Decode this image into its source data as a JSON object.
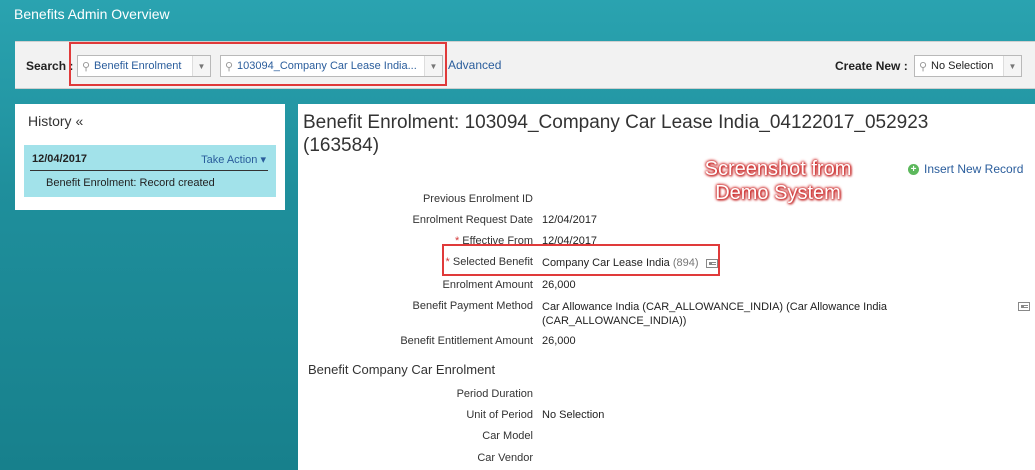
{
  "app": {
    "title": "Benefits Admin Overview"
  },
  "search": {
    "label": "Search :",
    "type_value": "Benefit Enrolment",
    "record_value": "103094_Company Car Lease India...",
    "advanced_label": "Advanced"
  },
  "create_new": {
    "label": "Create New :",
    "value": "No Selection"
  },
  "history": {
    "title": "History «",
    "entries": [
      {
        "date": "12/04/2017",
        "action_label": "Take Action ▾",
        "description": "Benefit Enrolment: Record created"
      }
    ]
  },
  "main": {
    "title": "Benefit Enrolment: 103094_Company Car Lease India_04122017_052923 (163584)",
    "insert_label": "Insert New Record",
    "annotation": "Screenshot from Demo System",
    "fields": {
      "previous_id": {
        "label": "Previous Enrolment ID",
        "value": ""
      },
      "request_date": {
        "label": "Enrolment Request Date",
        "value": "12/04/2017"
      },
      "effective_from": {
        "required_mark": "*",
        "label": "Effective From",
        "value": "12/04/2017"
      },
      "selected_benefit": {
        "required_mark": "*",
        "label": "Selected Benefit",
        "value": "Company Car Lease India",
        "value_id": "(894)"
      },
      "amount": {
        "label": "Enrolment Amount",
        "value": "26,000"
      },
      "payment_method": {
        "label": "Benefit Payment Method",
        "value": "Car Allowance India (CAR_ALLOWANCE_INDIA) (Car Allowance India (CAR_ALLOWANCE_INDIA))"
      },
      "entitlement": {
        "label": "Benefit Entitlement Amount",
        "value": "26,000"
      }
    },
    "section": {
      "title": "Benefit Company Car Enrolment",
      "period_duration": {
        "label": "Period Duration",
        "value": ""
      },
      "unit_of_period": {
        "label": "Unit of Period",
        "value": "No Selection"
      },
      "car_model": {
        "label": "Car Model",
        "value": ""
      },
      "car_vendor": {
        "label": "Car Vendor",
        "value": ""
      }
    }
  },
  "colors": {
    "highlight": "#e03a3a",
    "link": "#2a5d9c",
    "header_bg": "#1f8f9c",
    "history_card": "#a2e2ea"
  }
}
